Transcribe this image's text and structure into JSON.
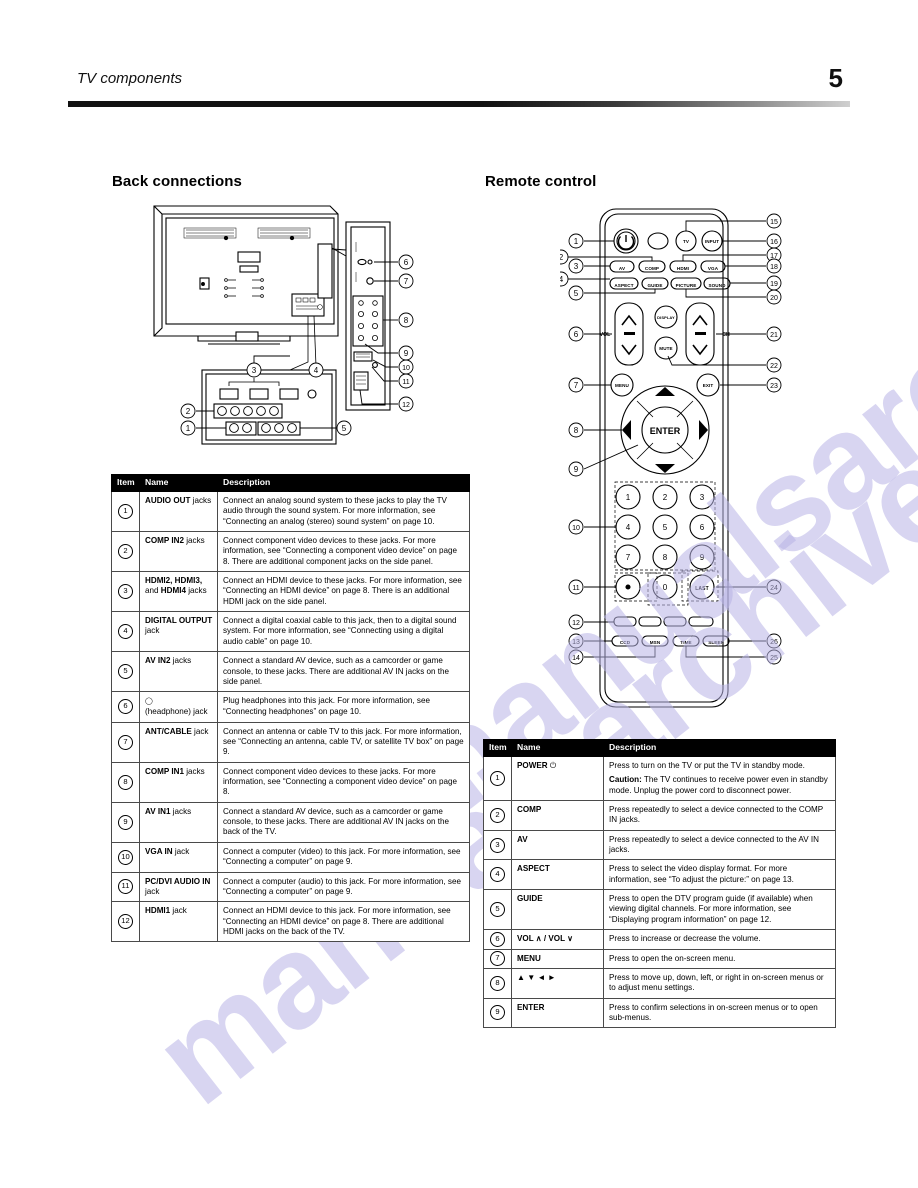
{
  "header": {
    "title": "TV components",
    "page_number": "5"
  },
  "watermark": {
    "line1": "manualsarchive",
    "line2": "manualsarchive"
  },
  "sections": {
    "back_connections": "Back connections",
    "remote_control": "Remote control"
  },
  "table_headers": {
    "item": "Item",
    "name": "Name",
    "description": "Description"
  },
  "back_connections_rows": [
    {
      "item": "1",
      "name_bold": "AUDIO OUT",
      "name_rest": " jacks",
      "description": "Connect an analog sound system to these jacks to play the TV audio through the sound system. For more information, see “Connecting an analog (stereo) sound system” on page  10."
    },
    {
      "item": "2",
      "name_bold": "COMP IN2",
      "name_rest": " jacks",
      "description": "Connect component video devices to these jacks. For more information, see “Connecting a component video device” on page 8. There are additional component jacks on the side panel."
    },
    {
      "item": "3",
      "name_bold": "HDMI2, HDMI3,",
      "name_rest": " and ",
      "name_bold2": "HDMI4",
      "name_rest2": " jacks",
      "description": "Connect an HDMI device to these jacks. For more information, see “Connecting an HDMI device” on page 8. There is an additional HDMI jack on the side panel."
    },
    {
      "item": "4",
      "name_bold": "DIGITAL OUTPUT",
      "name_rest": " jack",
      "description": "Connect a digital coaxial cable to this jack, then to a digital sound system. For more information, see “Connecting using a digital audio cable” on page 10."
    },
    {
      "item": "5",
      "name_bold": "AV IN2",
      "name_rest": " jacks",
      "description": "Connect a standard AV device, such as a camcorder or game console, to these jacks. There are additional AV IN jacks on the side panel."
    },
    {
      "item": "6",
      "name_bold": "",
      "name_rest": "(headphone) jack",
      "name_icon": "headphone-jack-icon",
      "description": "Plug headphones into this jack. For more information, see “Connecting headphones” on page 10."
    },
    {
      "item": "7",
      "name_bold": "ANT/CABLE",
      "name_rest": " jack",
      "description": "Connect an antenna or cable TV to this jack. For more information, see “Connecting an antenna, cable TV, or satellite TV box” on page 9."
    },
    {
      "item": "8",
      "name_bold": "COMP IN1",
      "name_rest": " jacks",
      "description": "Connect component video devices to these jacks. For more information, see “Connecting a component video device” on page 8."
    },
    {
      "item": "9",
      "name_bold": "AV IN1",
      "name_rest": " jacks",
      "description": "Connect a standard AV device, such as a camcorder or game console, to these jacks. There are additional AV IN jacks on the back of the TV."
    },
    {
      "item": "10",
      "name_bold": "VGA IN",
      "name_rest": " jack",
      "description": "Connect a computer (video) to this jack. For more information, see “Connecting a computer” on page 9."
    },
    {
      "item": "11",
      "name_bold": "PC/DVI AUDIO IN",
      "name_rest": " jack",
      "description": "Connect a computer (audio) to this jack. For more information, see “Connecting a computer” on page 9."
    },
    {
      "item": "12",
      "name_bold": "HDMI1",
      "name_rest": " jack",
      "description": "Connect an HDMI device to this jack. For more information, see “Connecting an HDMI device” on page 8. There are additional HDMI jacks on the back of the TV."
    }
  ],
  "remote_rows": [
    {
      "item": "1",
      "name_bold": "POWER",
      "name_rest": " ⏻",
      "description": "Press to turn on the TV or put the TV in standby mode.",
      "description2_bold": "Caution:",
      "description2": " The TV continues to receive power even in standby mode. Unplug the power cord to disconnect power."
    },
    {
      "item": "2",
      "name_bold": "COMP",
      "name_rest": "",
      "description": "Press repeatedly to select a device connected to the COMP IN jacks."
    },
    {
      "item": "3",
      "name_bold": "AV",
      "name_rest": "",
      "description": "Press repeatedly to select a device connected to the AV IN jacks."
    },
    {
      "item": "4",
      "name_bold": "ASPECT",
      "name_rest": "",
      "description": "Press to select the video display format. For more information, see “To adjust the picture:” on page 13."
    },
    {
      "item": "5",
      "name_bold": "GUIDE",
      "name_rest": "",
      "description": "Press to open the DTV program guide (if available) when viewing digital channels. For more information, see “Displaying program information” on page 12."
    },
    {
      "item": "6",
      "name_bold": "VOL ∧ / VOL ∨",
      "name_rest": "",
      "description": "Press to increase or decrease the volume."
    },
    {
      "item": "7",
      "name_bold": "MENU",
      "name_rest": "",
      "description": "Press to open the on-screen menu."
    },
    {
      "item": "8",
      "name_bold": "▲ ▼ ◄ ►",
      "name_rest": "",
      "description": "Press to move up, down, left, or right in on-screen menus or to adjust menu settings."
    },
    {
      "item": "9",
      "name_bold": "ENTER",
      "name_rest": "",
      "description": "Press to confirm selections in on-screen menus or to open sub-menus."
    }
  ],
  "tv_diagram": {
    "callouts": [
      "1",
      "2",
      "3",
      "4",
      "5",
      "6",
      "7",
      "8",
      "9",
      "10",
      "11",
      "12"
    ]
  },
  "remote_diagram": {
    "callouts": [
      "1",
      "2",
      "3",
      "4",
      "5",
      "6",
      "7",
      "8",
      "9",
      "10",
      "11",
      "12",
      "13",
      "14",
      "15",
      "16",
      "17",
      "18",
      "19",
      "20",
      "21",
      "22",
      "23",
      "24",
      "25",
      "26"
    ],
    "buttons": {
      "tv": "TV",
      "input": "INPUT",
      "av": "AV",
      "comp": "COMP",
      "hdmi": "HDMI",
      "vga": "VGA",
      "aspect": "ASPECT",
      "guide": "GUIDE",
      "picture": "PICTURE",
      "sound": "SOUND",
      "vol": "VOL",
      "ch": "CH",
      "display": "DISPLAY",
      "mute": "MUTE",
      "menu": "MENU",
      "exit": "EXIT",
      "enter": "ENTER",
      "last": "LAST",
      "ccd": "CCD",
      "wssp": "MSN",
      "time": "TIME",
      "sleep": "SLEEP",
      "keys": [
        "1",
        "2",
        "3",
        "4",
        "5",
        "6",
        "7",
        "8",
        "9",
        ".",
        "0"
      ]
    }
  }
}
